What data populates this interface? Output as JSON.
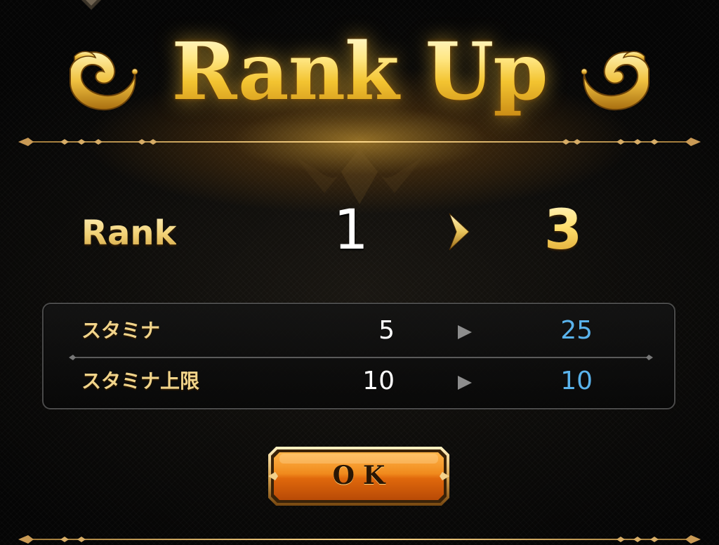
{
  "title": "Rank Up",
  "rank": {
    "label": "Rank",
    "from": "1",
    "to": "3"
  },
  "stats": [
    {
      "name": "スタミナ",
      "from": "5",
      "to": "25"
    },
    {
      "name": "スタミナ上限",
      "from": "10",
      "to": "10"
    }
  ],
  "ok_button": {
    "label": "OK"
  },
  "colors": {
    "gold": "#f3c431",
    "new_value_blue": "#5ab3ec",
    "button_orange": "#ee7a14",
    "panel_border": "#4a4a4a"
  },
  "icons": {
    "rank_arrow": "chevron-right-icon",
    "stat_arrow": "triangle-right-icon",
    "flourish": "scroll-flourish-icon"
  }
}
